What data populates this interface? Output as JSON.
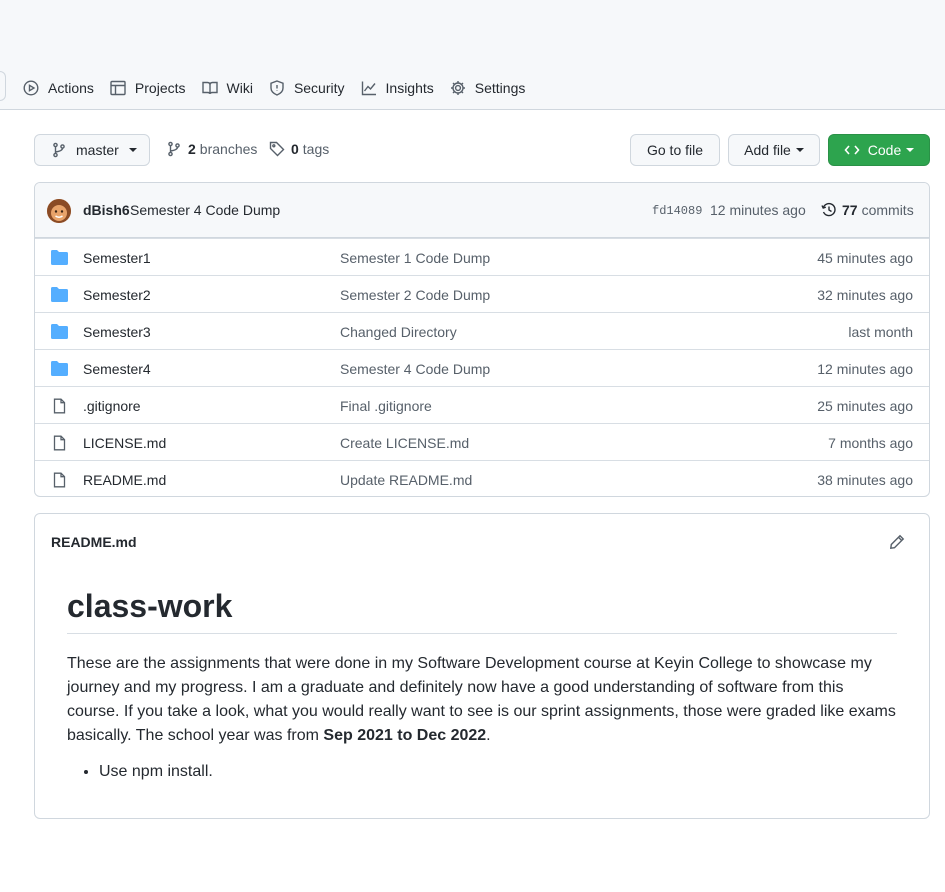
{
  "nav": {
    "tabs": [
      {
        "label": "Actions",
        "icon": "play-circle-icon"
      },
      {
        "label": "Projects",
        "icon": "table-icon"
      },
      {
        "label": "Wiki",
        "icon": "book-icon"
      },
      {
        "label": "Security",
        "icon": "shield-icon"
      },
      {
        "label": "Insights",
        "icon": "graph-icon"
      },
      {
        "label": "Settings",
        "icon": "gear-icon"
      }
    ]
  },
  "toolbar": {
    "branch": "master",
    "branches_count": "2",
    "branches_label": "branches",
    "tags_count": "0",
    "tags_label": "tags",
    "go_to_file": "Go to file",
    "add_file": "Add file",
    "code": "Code"
  },
  "commit": {
    "author": "dBish6",
    "message": "Semester 4 Code Dump",
    "sha": "fd14089",
    "time": "12 minutes ago",
    "commits_count": "77",
    "commits_label": "commits"
  },
  "files": [
    {
      "type": "dir",
      "name": "Semester1",
      "message": "Semester 1 Code Dump",
      "age": "45 minutes ago"
    },
    {
      "type": "dir",
      "name": "Semester2",
      "message": "Semester 2 Code Dump",
      "age": "32 minutes ago"
    },
    {
      "type": "dir",
      "name": "Semester3",
      "message": "Changed Directory",
      "age": "last month"
    },
    {
      "type": "dir",
      "name": "Semester4",
      "message": "Semester 4 Code Dump",
      "age": "12 minutes ago"
    },
    {
      "type": "file",
      "name": ".gitignore",
      "message": "Final .gitignore",
      "age": "25 minutes ago"
    },
    {
      "type": "file",
      "name": "LICENSE.md",
      "message": "Create LICENSE.md",
      "age": "7 months ago"
    },
    {
      "type": "file",
      "name": "README.md",
      "message": "Update README.md",
      "age": "38 minutes ago"
    }
  ],
  "readme": {
    "filename": "README.md",
    "heading": "class-work",
    "paragraph_text": "These are the assignments that were done in my Software Development course at Keyin College to showcase my journey and my progress. I am a graduate and definitely now have a good understanding of software from this course. If you take a look, what you would really want to see is our sprint assignments, those were graded like exams basically. The school year was from ",
    "paragraph_bold": "Sep 2021 to Dec 2022",
    "paragraph_end": ".",
    "bullets": [
      "Use npm install."
    ]
  },
  "colors": {
    "code_button": "#2da44e",
    "folder": "#54aeff",
    "header_bg": "#f6f8fa",
    "border": "#d0d7de"
  }
}
